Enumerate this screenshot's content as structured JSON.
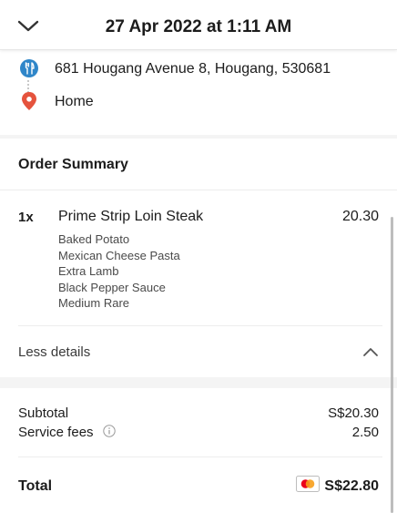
{
  "header": {
    "title": "27 Apr 2022 at 1:11 AM",
    "back_icon": "chevron-down-icon"
  },
  "locations": {
    "pickup": {
      "text": "681 Hougang Avenue 8, Hougang, 530681",
      "icon": "restaurant-icon",
      "color": "#2f86c9"
    },
    "dropoff": {
      "text": "Home",
      "icon": "location-pin-icon",
      "color": "#e5533d"
    }
  },
  "order_summary": {
    "title": "Order Summary",
    "items": [
      {
        "qty": "1x",
        "name": "Prime Strip Loin Steak",
        "price": "20.30",
        "modifiers": [
          "Baked Potato",
          "Mexican Cheese Pasta",
          "Extra Lamb",
          "Black Pepper Sauce",
          "Medium Rare"
        ]
      }
    ],
    "less_details_label": "Less details"
  },
  "totals": {
    "subtotal_label": "Subtotal",
    "subtotal_value": "S$20.30",
    "service_fees_label": "Service fees",
    "service_fees_value": "2.50",
    "total_label": "Total",
    "total_value": "S$22.80",
    "payment_icon": "mastercard-icon"
  }
}
